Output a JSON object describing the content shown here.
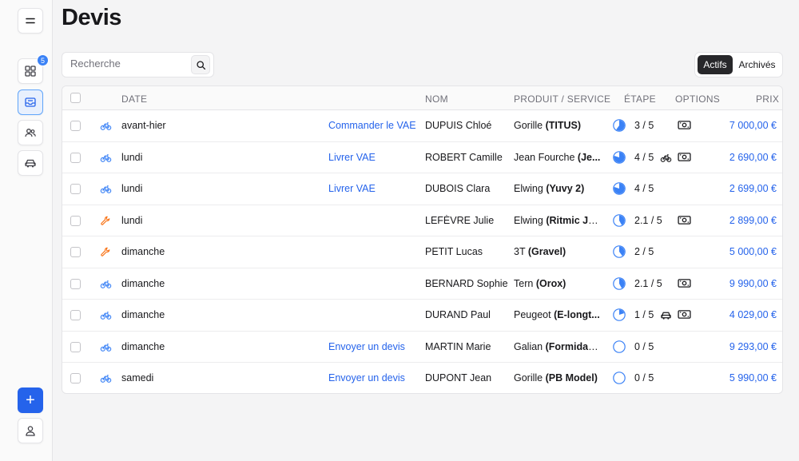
{
  "page": {
    "title": "Devis"
  },
  "sidebar": {
    "badge_count": "5",
    "add_label": "+"
  },
  "search": {
    "placeholder": "Recherche",
    "value": ""
  },
  "filter": {
    "active_label": "Actifs",
    "archived_label": "Archivés",
    "selected": "Actifs"
  },
  "table": {
    "headers": {
      "date": "DATE",
      "nom": "NOM",
      "produit": "PRODUIT / SERVICE",
      "etape": "ÉTAPE",
      "options": "OPTIONS",
      "prix": "PRIX"
    },
    "rows": [
      {
        "type": "bicycle-icon",
        "date": "avant-hier",
        "action": "Commander le VAE",
        "nom": "DUPUIS Chloé",
        "produit_brand": "Gorille",
        "produit_model": "(TITUS)",
        "etape_value": 3,
        "etape_total": 5,
        "etape": "3 / 5",
        "options": [
          "cash-icon"
        ],
        "prix": "7 000,00 €"
      },
      {
        "type": "bicycle-icon",
        "date": "lundi",
        "action": "Livrer VAE",
        "nom": "ROBERT Camille",
        "produit_brand": "Jean Fourche",
        "produit_model": "(Je...",
        "etape_value": 4,
        "etape_total": 5,
        "etape": "4 / 5",
        "options": [
          "bicycle-icon",
          "cash-icon"
        ],
        "prix": "2 690,00 €"
      },
      {
        "type": "bicycle-icon",
        "date": "lundi",
        "action": "Livrer VAE",
        "nom": "DUBOIS Clara",
        "produit_brand": "Elwing",
        "produit_model": "(Yuvy 2)",
        "etape_value": 4,
        "etape_total": 5,
        "etape": "4 / 5",
        "options": [],
        "prix": "2 699,00 €"
      },
      {
        "type": "wrench-icon",
        "date": "lundi",
        "action": "",
        "nom": "LEFÈVRE Julie",
        "produit_brand": "Elwing",
        "produit_model": "(Ritmic Ju...",
        "etape_value": 2.1,
        "etape_total": 5,
        "etape": "2.1 / 5",
        "options": [
          "cash-icon"
        ],
        "prix": "2 899,00 €"
      },
      {
        "type": "wrench-icon",
        "date": "dimanche",
        "action": "",
        "nom": "PETIT Lucas",
        "produit_brand": "3T",
        "produit_model": "(Gravel)",
        "etape_value": 2,
        "etape_total": 5,
        "etape": "2 / 5",
        "options": [],
        "prix": "5 000,00 €"
      },
      {
        "type": "bicycle-icon",
        "date": "dimanche",
        "action": "",
        "nom": "BERNARD Sophie",
        "produit_brand": "Tern",
        "produit_model": "(Orox)",
        "etape_value": 2.1,
        "etape_total": 5,
        "etape": "2.1 / 5",
        "options": [
          "cash-icon"
        ],
        "prix": "9 990,00 €"
      },
      {
        "type": "bicycle-icon",
        "date": "dimanche",
        "action": "",
        "nom": "DURAND Paul",
        "produit_brand": "Peugeot",
        "produit_model": "(E-longt...",
        "etape_value": 1,
        "etape_total": 5,
        "etape": "1 / 5",
        "options": [
          "car-icon",
          "cash-icon"
        ],
        "prix": "4 029,00 €"
      },
      {
        "type": "bicycle-icon",
        "date": "dimanche",
        "action": "Envoyer un devis",
        "nom": "MARTIN Marie",
        "produit_brand": "Galian",
        "produit_model": "(Formidable)",
        "etape_value": 0,
        "etape_total": 5,
        "etape": "0 / 5",
        "options": [],
        "prix": "9 293,00 €"
      },
      {
        "type": "bicycle-icon",
        "date": "samedi",
        "action": "Envoyer un devis",
        "nom": "DUPONT Jean",
        "produit_brand": "Gorille",
        "produit_model": "(PB Model)",
        "etape_value": 0,
        "etape_total": 5,
        "etape": "0 / 5",
        "options": [],
        "prix": "5 990,00 €"
      }
    ]
  },
  "colors": {
    "accent": "#2563eb",
    "bike": "#3b82f6",
    "wrench": "#f97316",
    "text_muted": "#71717a"
  }
}
